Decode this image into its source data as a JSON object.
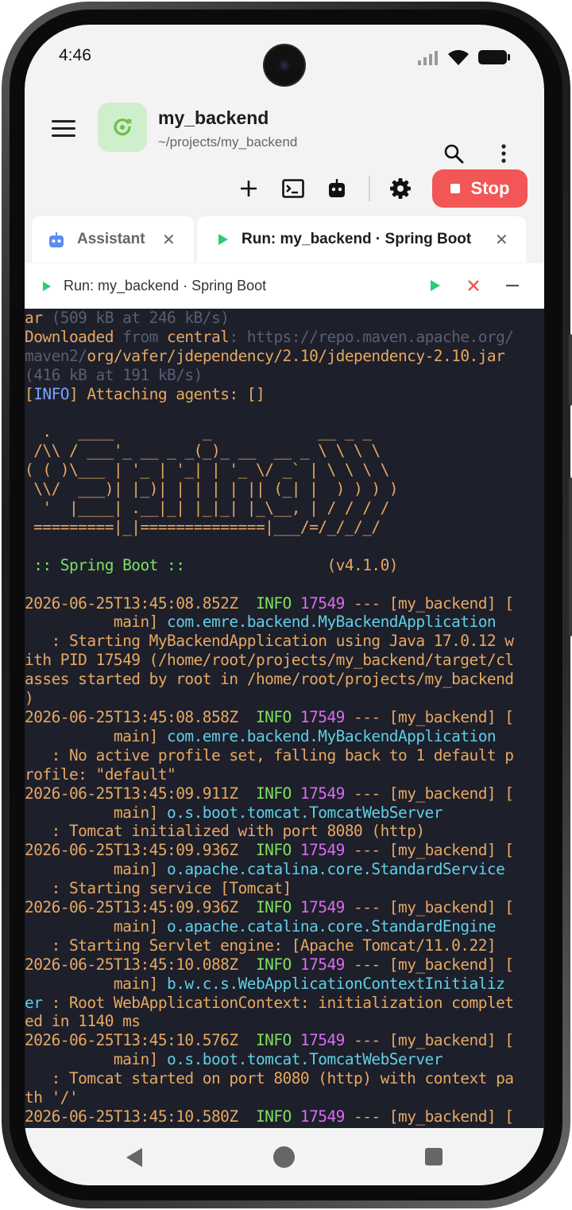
{
  "status": {
    "time": "4:46"
  },
  "app": {
    "title": "my_backend",
    "path": "~/projects/my_backend",
    "stop_label": "Stop"
  },
  "tabs": [
    {
      "label": "Assistant",
      "icon": "robot-icon"
    },
    {
      "label": "Run: my_backend · Spring Boot",
      "icon": "play-icon"
    }
  ],
  "run_panel": {
    "title": "Run: my_backend · Spring Boot"
  },
  "console": {
    "lines": [
      [
        {
          "t": "ar ",
          "c": ""
        },
        {
          "t": "(509 kB at 246 kB/s)",
          "c": "gray"
        }
      ],
      [
        {
          "t": "Downloaded ",
          "c": ""
        },
        {
          "t": "from ",
          "c": "gray"
        },
        {
          "t": "central",
          "c": ""
        },
        {
          "t": ": https://repo.maven.apache.org/",
          "c": "gray"
        }
      ],
      [
        {
          "t": "maven2/",
          "c": "gray"
        },
        {
          "t": "org/vafer/jdependency/2.10/jdependency-2.10.jar",
          "c": ""
        }
      ],
      [
        {
          "t": "(416 kB at 191 kB/s)",
          "c": "gray"
        }
      ],
      [
        {
          "t": "[",
          "c": ""
        },
        {
          "t": "INFO",
          "c": "blue"
        },
        {
          "t": "] Attaching agents: []",
          "c": ""
        }
      ],
      [
        {
          "t": "",
          "c": ""
        }
      ],
      [
        {
          "t": "  .   ____          _            __ _ _",
          "c": ""
        }
      ],
      [
        {
          "t": " /\\\\ / ___'_ __ _ _(_)_ __  __ _ \\ \\ \\ \\",
          "c": ""
        }
      ],
      [
        {
          "t": "( ( )\\___ | '_ | '_| | '_ \\/ _` | \\ \\ \\ \\",
          "c": ""
        }
      ],
      [
        {
          "t": " \\\\/  ___)| |_)| | | | | || (_| |  ) ) ) )",
          "c": ""
        }
      ],
      [
        {
          "t": "  '  |____| .__|_| |_|_| |_\\__, | / / / /",
          "c": ""
        }
      ],
      [
        {
          "t": " =========|_|==============|___/=/_/_/_/",
          "c": ""
        }
      ],
      [
        {
          "t": "",
          "c": ""
        }
      ],
      [
        {
          "t": " :: Spring Boot ::",
          "c": "green"
        },
        {
          "t": "                (v4.1.0)",
          "c": ""
        }
      ],
      [
        {
          "t": "",
          "c": ""
        }
      ],
      [
        {
          "t": "2026-06-25T13:45:08.852Z  ",
          "c": ""
        },
        {
          "t": "INFO ",
          "c": "green"
        },
        {
          "t": "17549",
          "c": "mag"
        },
        {
          "t": " --- [my_backend] [",
          "c": ""
        }
      ],
      [
        {
          "t": "          main] ",
          "c": ""
        },
        {
          "t": "com.emre.backend.MyBackendApplication",
          "c": "cyan"
        }
      ],
      [
        {
          "t": "   : Starting MyBackendApplication using Java 17.0.12 w",
          "c": ""
        }
      ],
      [
        {
          "t": "ith PID 17549 (/home/root/projects/my_backend/target/cl",
          "c": ""
        }
      ],
      [
        {
          "t": "asses started by root in /home/root/projects/my_backend",
          "c": ""
        }
      ],
      [
        {
          "t": ")",
          "c": ""
        }
      ],
      [
        {
          "t": "2026-06-25T13:45:08.858Z  ",
          "c": ""
        },
        {
          "t": "INFO ",
          "c": "green"
        },
        {
          "t": "17549",
          "c": "mag"
        },
        {
          "t": " --- [my_backend] [",
          "c": ""
        }
      ],
      [
        {
          "t": "          main] ",
          "c": ""
        },
        {
          "t": "com.emre.backend.MyBackendApplication",
          "c": "cyan"
        }
      ],
      [
        {
          "t": "   : No active profile set, falling back to 1 default p",
          "c": ""
        }
      ],
      [
        {
          "t": "rofile: \"default\"",
          "c": ""
        }
      ],
      [
        {
          "t": "2026-06-25T13:45:09.911Z  ",
          "c": ""
        },
        {
          "t": "INFO ",
          "c": "green"
        },
        {
          "t": "17549",
          "c": "mag"
        },
        {
          "t": " --- [my_backend] [",
          "c": ""
        }
      ],
      [
        {
          "t": "          main] ",
          "c": ""
        },
        {
          "t": "o.s.boot.tomcat.TomcatWebServer",
          "c": "cyan"
        }
      ],
      [
        {
          "t": "   : Tomcat initialized with port 8080 (http)",
          "c": ""
        }
      ],
      [
        {
          "t": "2026-06-25T13:45:09.936Z  ",
          "c": ""
        },
        {
          "t": "INFO ",
          "c": "green"
        },
        {
          "t": "17549",
          "c": "mag"
        },
        {
          "t": " --- [my_backend] [",
          "c": ""
        }
      ],
      [
        {
          "t": "          main] ",
          "c": ""
        },
        {
          "t": "o.apache.catalina.core.StandardService",
          "c": "cyan"
        }
      ],
      [
        {
          "t": "   : Starting service [Tomcat]",
          "c": ""
        }
      ],
      [
        {
          "t": "2026-06-25T13:45:09.936Z  ",
          "c": ""
        },
        {
          "t": "INFO ",
          "c": "green"
        },
        {
          "t": "17549",
          "c": "mag"
        },
        {
          "t": " --- [my_backend] [",
          "c": ""
        }
      ],
      [
        {
          "t": "          main] ",
          "c": ""
        },
        {
          "t": "o.apache.catalina.core.StandardEngine",
          "c": "cyan"
        }
      ],
      [
        {
          "t": "   : Starting Servlet engine: [Apache Tomcat/11.0.22]",
          "c": ""
        }
      ],
      [
        {
          "t": "2026-06-25T13:45:10.088Z  ",
          "c": ""
        },
        {
          "t": "INFO ",
          "c": "green"
        },
        {
          "t": "17549",
          "c": "mag"
        },
        {
          "t": " --- [my_backend] [",
          "c": ""
        }
      ],
      [
        {
          "t": "          main] ",
          "c": ""
        },
        {
          "t": "b.w.c.s.WebApplicationContextInitializ",
          "c": "cyan"
        }
      ],
      [
        {
          "t": "er",
          "c": "cyan"
        },
        {
          "t": " : Root WebApplicationContext: initialization complet",
          "c": ""
        }
      ],
      [
        {
          "t": "ed in 1140 ms",
          "c": ""
        }
      ],
      [
        {
          "t": "2026-06-25T13:45:10.576Z  ",
          "c": ""
        },
        {
          "t": "INFO ",
          "c": "green"
        },
        {
          "t": "17549",
          "c": "mag"
        },
        {
          "t": " --- [my_backend] [",
          "c": ""
        }
      ],
      [
        {
          "t": "          main] ",
          "c": ""
        },
        {
          "t": "o.s.boot.tomcat.TomcatWebServer",
          "c": "cyan"
        }
      ],
      [
        {
          "t": "   : Tomcat started on port 8080 (http) with context pa",
          "c": ""
        }
      ],
      [
        {
          "t": "th '/'",
          "c": ""
        }
      ],
      [
        {
          "t": "2026-06-25T13:45:10.580Z  ",
          "c": ""
        },
        {
          "t": "INFO ",
          "c": "green"
        },
        {
          "t": "17549",
          "c": "mag"
        },
        {
          "t": " --- [my_backend] [",
          "c": ""
        }
      ]
    ]
  },
  "colors": {
    "accent_stop": "#f25656",
    "play_green": "#2ecc71",
    "console_bg": "#1d1f2b",
    "console_text": "#e8a860",
    "logo_bg": "#cfeecb"
  }
}
